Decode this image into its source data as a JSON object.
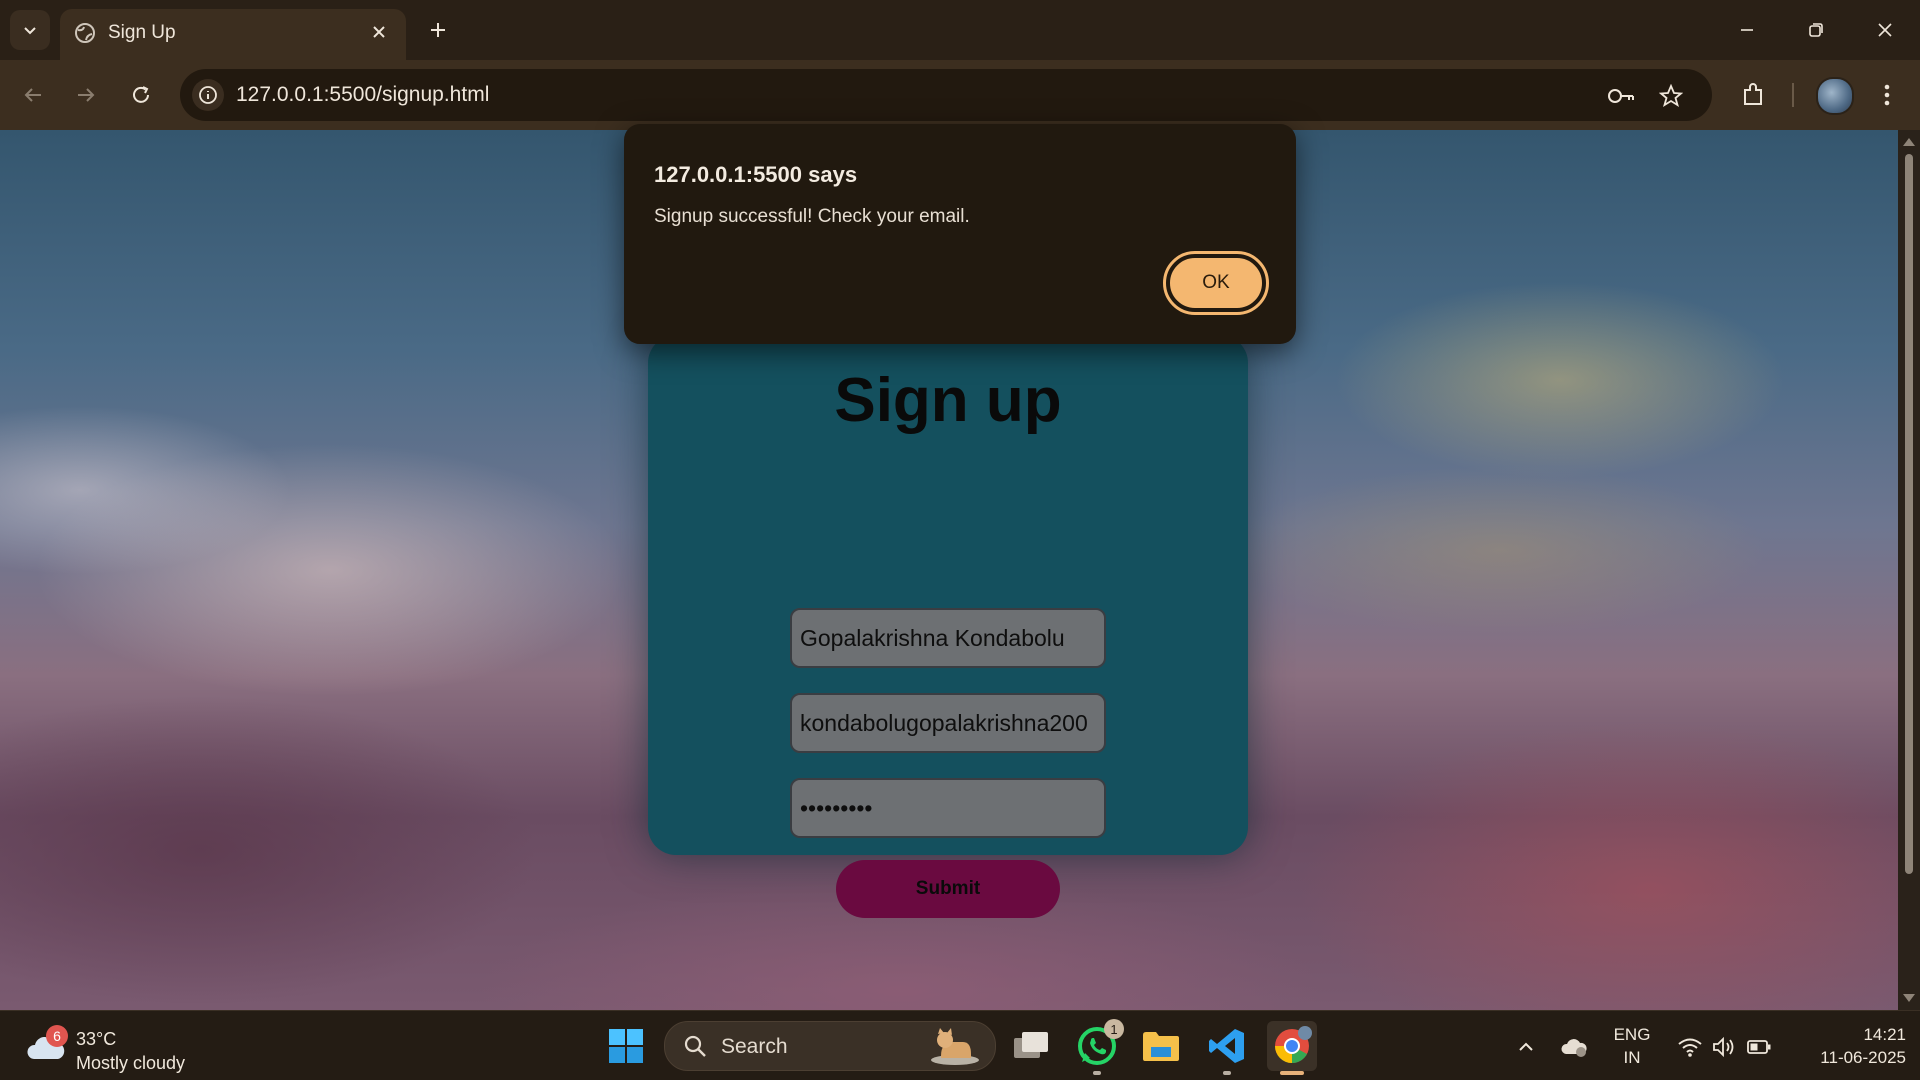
{
  "browser": {
    "tab_title": "Sign Up",
    "url": "127.0.0.1:5500/signup.html",
    "icons": [
      "tab-search-icon",
      "globe-icon",
      "close-icon",
      "plus-icon",
      "minimize-icon",
      "restore-icon",
      "back-icon",
      "forward-icon",
      "reload-icon",
      "info-icon",
      "key-icon",
      "star-icon",
      "extensions-icon",
      "menu-dots-icon"
    ]
  },
  "page": {
    "title": "Sign up",
    "name_value": "Gopalakrishna Kondabolu",
    "email_value": "kondabolugopalakrishna200",
    "password_value": "•••••••••",
    "submit_label": "Submit",
    "colors": {
      "card": "#14505e",
      "submit": "#6a0a40",
      "field": "#6d7073"
    }
  },
  "dialog": {
    "title": "127.0.0.1:5500 says",
    "message": "Signup successful! Check your email.",
    "ok_label": "OK",
    "accent": "#f4b770"
  },
  "taskbar": {
    "weather_badge": "6",
    "temperature": "33°C",
    "weather_desc": "Mostly cloudy",
    "search_label": "Search",
    "whatsapp_badge": "1",
    "lang_line1": "ENG",
    "lang_line2": "IN",
    "time": "14:21",
    "date": "11-06-2025"
  }
}
